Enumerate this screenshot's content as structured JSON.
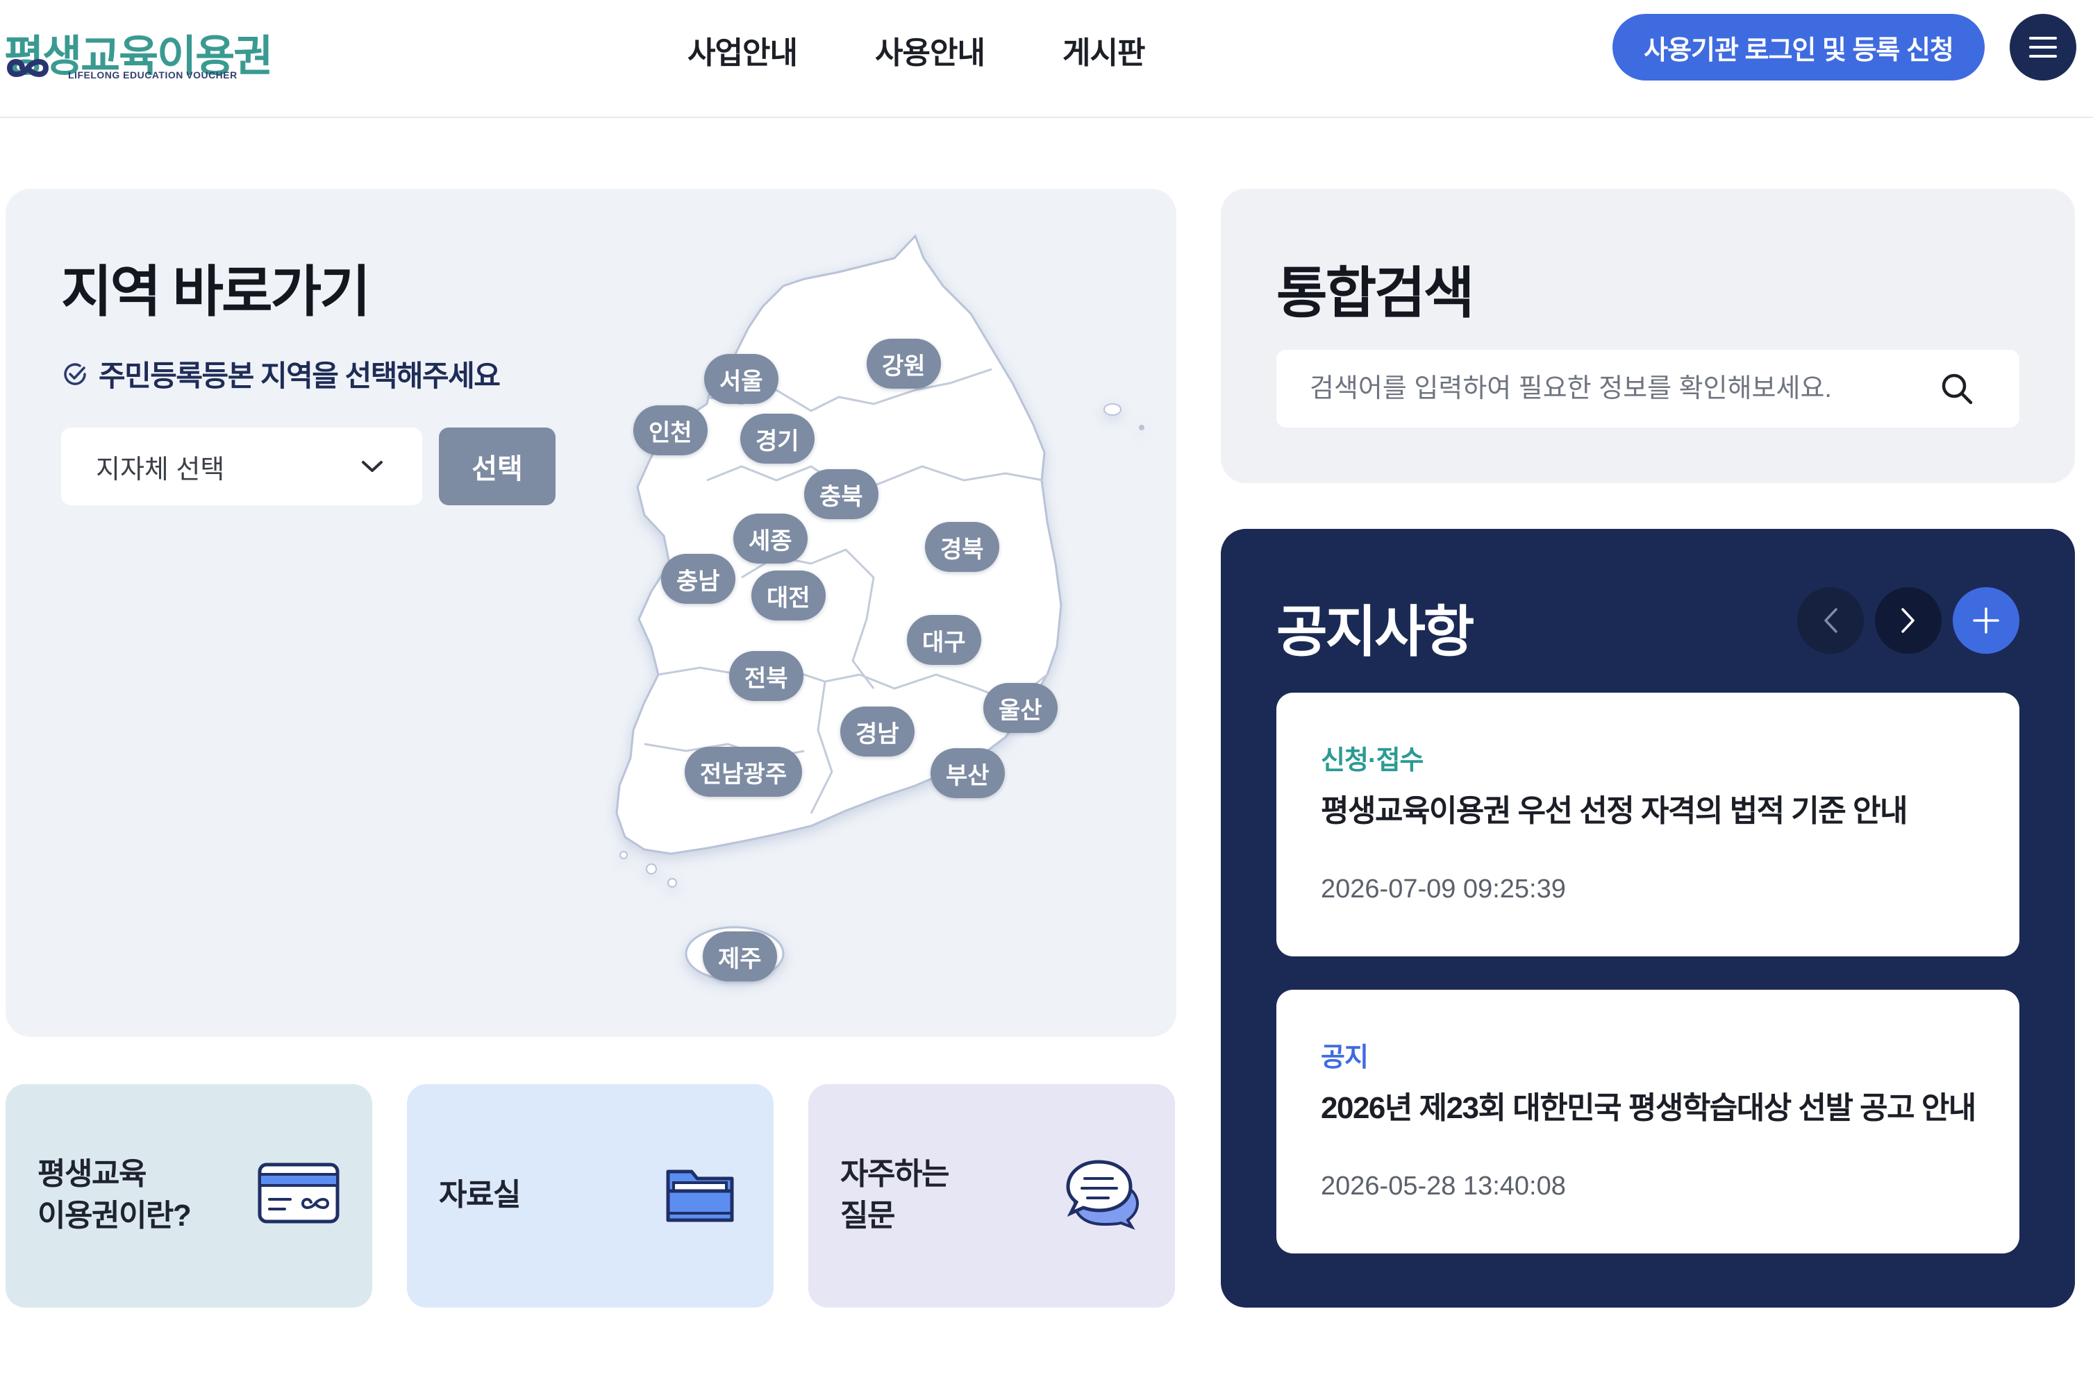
{
  "header": {
    "logo_text": "평생교육이용권",
    "logo_sub": "LIFELONG EDUCATION VOUCHER",
    "nav": [
      "사업안내",
      "사용안내",
      "게시판"
    ],
    "login_label": "사용기관 로그인 및 등록 신청"
  },
  "region": {
    "title": "지역 바로가기",
    "hint": "주민등록등본 지역을 선택해주세요",
    "select_value": "지자체 선택",
    "select_button": "선택",
    "regions": [
      "서울",
      "강원",
      "인천",
      "경기",
      "충북",
      "세종",
      "경북",
      "충남",
      "대전",
      "대구",
      "전북",
      "울산",
      "경남",
      "전남광주",
      "부산",
      "제주"
    ]
  },
  "quick": [
    {
      "line1": "평생교육",
      "line2": "이용권이란?"
    },
    {
      "line1": "자료실",
      "line2": ""
    },
    {
      "line1": "자주하는",
      "line2": "질문"
    }
  ],
  "search": {
    "title": "통합검색",
    "placeholder": "검색어를 입력하여 필요한 정보를 확인해보세요."
  },
  "notice": {
    "title": "공지사항",
    "items": [
      {
        "category": "신청·접수",
        "category_color": "#2a9a93",
        "title": "평생교육이용권 우선 선정 자격의 법적 기준 안내",
        "date": "2026-07-09 09:25:39"
      },
      {
        "category": "공지",
        "category_color": "#3f6be0",
        "title": "2026년 제23회 대한민국 평생학습대상 선발 공고 안내",
        "date": "2026-05-28 13:40:08"
      }
    ]
  },
  "colors": {
    "accent": "#3f6be0",
    "navy": "#1b2a55",
    "pill": "#7d8ba3",
    "teal": "#3a9a92"
  }
}
